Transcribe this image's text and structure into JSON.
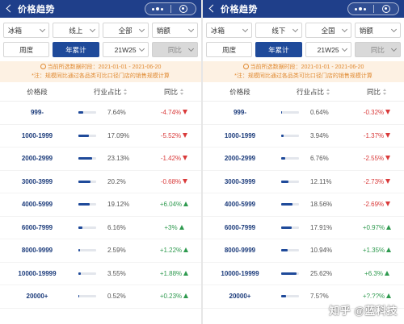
{
  "colors": {
    "header": "#1f3f8a",
    "accent": "#1f4a9a",
    "negative": "#d93a3a",
    "positive": "#2f9a4f",
    "notice_text": "#e08a32"
  },
  "panels": [
    {
      "title": "价格趋势",
      "filters": {
        "row1": [
          "冰箱",
          "线上",
          "全部",
          "销额"
        ],
        "row2": [
          "周度",
          "年累计",
          "21W25",
          "同比"
        ]
      },
      "notice": {
        "line1": "当前所选数据时段：2021-01-01 - 2021-06-20",
        "line2": "*注：规模同比通过各品类可比口径门店的销售规模计算"
      },
      "columns": [
        "价格段",
        "行业占比",
        "同比"
      ],
      "rows": [
        {
          "segment": "999-",
          "share": "7.64%",
          "share_value": 7.64,
          "change": "-4.74%",
          "direction": "down"
        },
        {
          "segment": "1000-1999",
          "share": "17.09%",
          "share_value": 17.09,
          "change": "-5.52%",
          "direction": "down"
        },
        {
          "segment": "2000-2999",
          "share": "23.13%",
          "share_value": 23.13,
          "change": "-1.42%",
          "direction": "down"
        },
        {
          "segment": "3000-3999",
          "share": "20.2%",
          "share_value": 20.2,
          "change": "-0.68%",
          "direction": "down"
        },
        {
          "segment": "4000-5999",
          "share": "19.12%",
          "share_value": 19.12,
          "change": "+6.04%",
          "direction": "up"
        },
        {
          "segment": "6000-7999",
          "share": "6.16%",
          "share_value": 6.16,
          "change": "+3%",
          "direction": "up"
        },
        {
          "segment": "8000-9999",
          "share": "2.59%",
          "share_value": 2.59,
          "change": "+1.22%",
          "direction": "up"
        },
        {
          "segment": "10000-19999",
          "share": "3.55%",
          "share_value": 3.55,
          "change": "+1.88%",
          "direction": "up"
        },
        {
          "segment": "20000+",
          "share": "0.52%",
          "share_value": 0.52,
          "change": "+0.23%",
          "direction": "up"
        }
      ]
    },
    {
      "title": "价格趋势",
      "filters": {
        "row1": [
          "冰箱",
          "线下",
          "全国",
          "销额"
        ],
        "row2": [
          "周度",
          "年累计",
          "21W25",
          "同比"
        ]
      },
      "notice": {
        "line1": "当前所选数据时段：2021-01-01 - 2021-06-20",
        "line2": "*注：规模同比通过各品类可比口径门店的销售规模计算"
      },
      "columns": [
        "价格段",
        "行业占比",
        "同比"
      ],
      "rows": [
        {
          "segment": "999-",
          "share": "0.64%",
          "share_value": 0.64,
          "change": "-0.32%",
          "direction": "down"
        },
        {
          "segment": "1000-1999",
          "share": "3.94%",
          "share_value": 3.94,
          "change": "-1.37%",
          "direction": "down"
        },
        {
          "segment": "2000-2999",
          "share": "6.76%",
          "share_value": 6.76,
          "change": "-2.55%",
          "direction": "down"
        },
        {
          "segment": "3000-3999",
          "share": "12.11%",
          "share_value": 12.11,
          "change": "-2.73%",
          "direction": "down"
        },
        {
          "segment": "4000-5999",
          "share": "18.56%",
          "share_value": 18.56,
          "change": "-2.69%",
          "direction": "down"
        },
        {
          "segment": "6000-7999",
          "share": "17.91%",
          "share_value": 17.91,
          "change": "+0.97%",
          "direction": "up"
        },
        {
          "segment": "8000-9999",
          "share": "10.94%",
          "share_value": 10.94,
          "change": "+1.35%",
          "direction": "up"
        },
        {
          "segment": "10000-19999",
          "share": "25.62%",
          "share_value": 25.62,
          "change": "+6.3%",
          "direction": "up"
        },
        {
          "segment": "20000+",
          "share": "7.5?%",
          "share_value": 7.5,
          "change": "+?.??%",
          "direction": "up"
        }
      ]
    }
  ],
  "watermark": "知乎 @蓝科技"
}
